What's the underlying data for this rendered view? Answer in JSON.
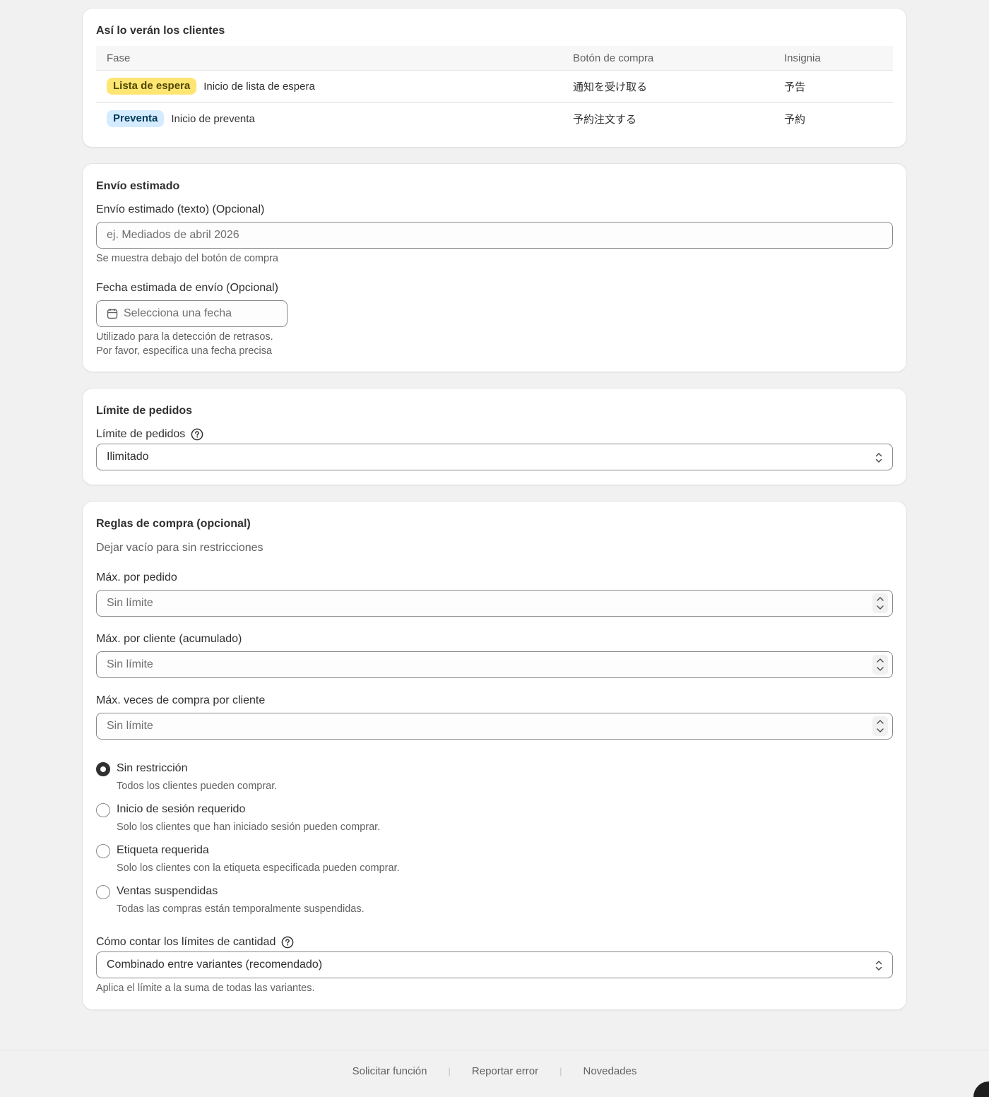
{
  "preview_card": {
    "title": "Así lo verán los clientes",
    "columns": [
      "Fase",
      "Botón de compra",
      "Insignia"
    ],
    "rows": [
      {
        "badge": "Lista de espera",
        "phase": "Inicio de lista de espera",
        "button": "通知を受け取る",
        "insignia": "予告",
        "badge_color": "#ffe673"
      },
      {
        "badge": "Preventa",
        "phase": "Inicio de preventa",
        "button": "予約注文する",
        "insignia": "予約",
        "badge_color": "#d5ebff"
      }
    ]
  },
  "shipping_card": {
    "title": "Envío estimado",
    "text_label": "Envío estimado (texto) (Opcional)",
    "text_placeholder": "ej. Mediados de abril 2026",
    "text_help": "Se muestra debajo del botón de compra",
    "date_label": "Fecha estimada de envío (Opcional)",
    "date_placeholder": "Selecciona una fecha",
    "date_help_1": "Utilizado para la detección de retrasos.",
    "date_help_2": "Por favor, especifica una fecha precisa",
    "date_icon": "calendar-icon"
  },
  "order_limit_card": {
    "title": "Límite de pedidos",
    "label": "Límite de pedidos",
    "help_icon": "question-circle-icon",
    "selected": "Ilimitado"
  },
  "purchase_rules_card": {
    "title": "Reglas de compra (opcional)",
    "subtitle": "Dejar vacío para sin restricciones",
    "max_per_order_label": "Máx. por pedido",
    "max_per_order_placeholder": "Sin límite",
    "max_per_customer_label": "Máx. por cliente (acumulado)",
    "max_per_customer_placeholder": "Sin límite",
    "max_times_label": "Máx. veces de compra por cliente",
    "max_times_placeholder": "Sin límite",
    "restriction_options": [
      {
        "label": "Sin restricción",
        "help": "Todos los clientes pueden comprar.",
        "checked": true
      },
      {
        "label": "Inicio de sesión requerido",
        "help": "Solo los clientes que han iniciado sesión pueden comprar.",
        "checked": false
      },
      {
        "label": "Etiqueta requerida",
        "help": "Solo los clientes con la etiqueta especificada pueden comprar.",
        "checked": false
      },
      {
        "label": "Ventas suspendidas",
        "help": "Todas las compras están temporalmente suspendidas.",
        "checked": false
      }
    ],
    "count_label": "Cómo contar los límites de cantidad",
    "count_selected": "Combinado entre variantes (recomendado)",
    "count_help": "Aplica el límite a la suma de todas las variantes."
  },
  "footer": {
    "links": [
      "Solicitar función",
      "Reportar error",
      "Novedades"
    ],
    "separator": "|"
  }
}
